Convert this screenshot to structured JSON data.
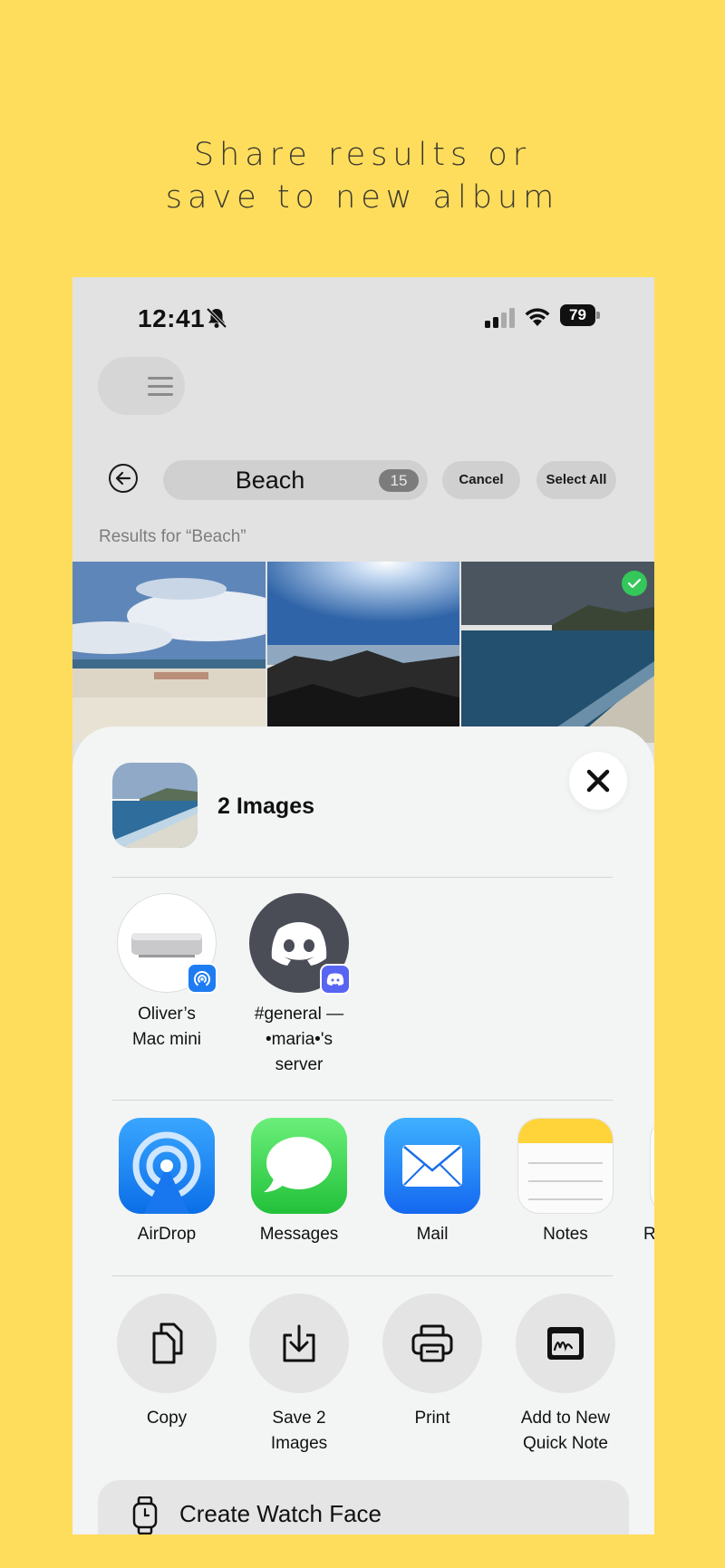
{
  "headline": {
    "line1": "Share results or",
    "line2": "save to new album"
  },
  "status_bar": {
    "time": "12:41",
    "battery": "79"
  },
  "search": {
    "query": "Beach",
    "count": "15",
    "cancel_label": "Cancel",
    "select_all_label": "Select All",
    "results_label": "Results for “Beach”"
  },
  "share_sheet": {
    "title": "2 Images",
    "contacts": [
      {
        "name_line1": "Oliver’s",
        "name_line2": "Mac mini",
        "name_line3": ""
      },
      {
        "name_line1": "#general —",
        "name_line2": "•maria•'s",
        "name_line3": "server"
      }
    ],
    "apps": [
      {
        "label": "AirDrop"
      },
      {
        "label": "Messages"
      },
      {
        "label": "Mail"
      },
      {
        "label": "Notes"
      },
      {
        "label": "R"
      }
    ],
    "actions": [
      {
        "line1": "Copy",
        "line2": ""
      },
      {
        "line1": "Save 2",
        "line2": "Images"
      },
      {
        "line1": "Print",
        "line2": ""
      },
      {
        "line1": "Add to New",
        "line2": "Quick Note"
      }
    ],
    "watch_face_label": "Create Watch Face"
  },
  "colors": {
    "background": "#FFDD5C",
    "check": "#34c759",
    "airdrop": "#1e7cf2",
    "messages": "#34c759"
  }
}
